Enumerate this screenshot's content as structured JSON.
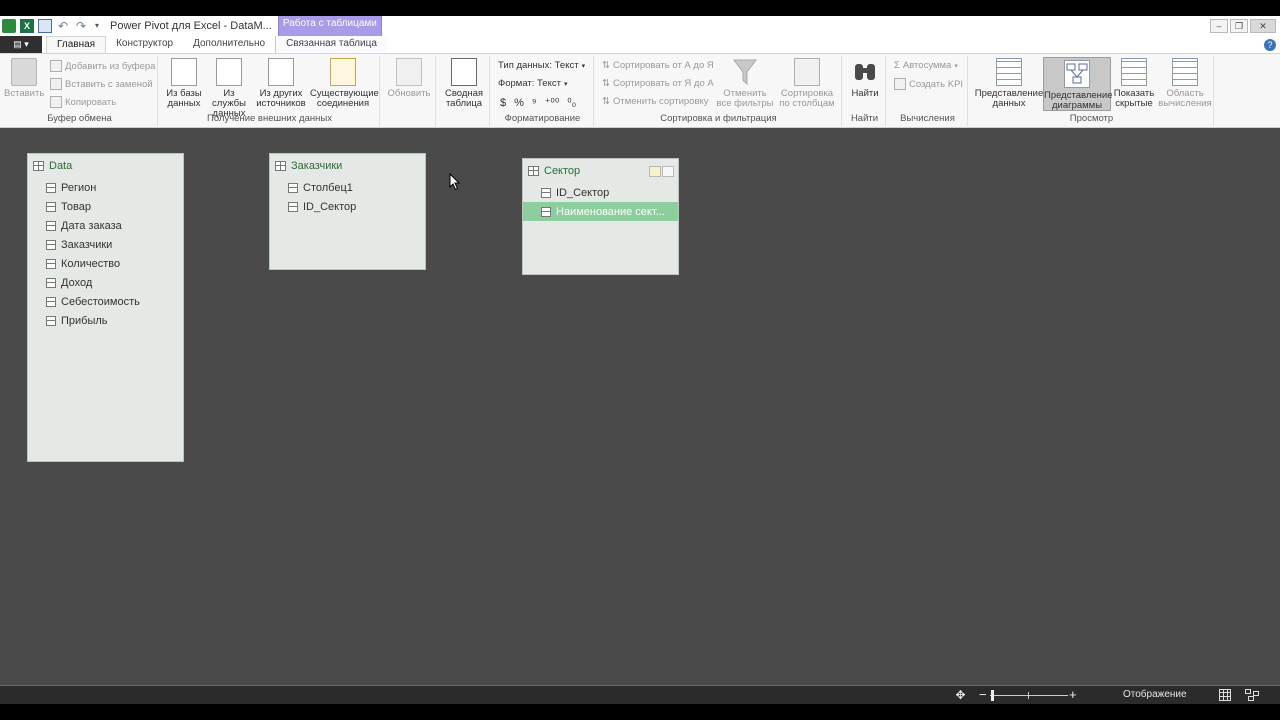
{
  "window": {
    "title": "Power Pivot для Excel - DataM...",
    "context_tab_title": "Работа с таблицами"
  },
  "tabs": {
    "file": "▤ ▾",
    "items": [
      "Главная",
      "Конструктор",
      "Дополнительно",
      "Связанная таблица"
    ],
    "active": "Главная"
  },
  "ribbon": {
    "clipboard": {
      "paste": "Вставить",
      "add_from_clipboard": "Добавить из буфера",
      "paste_replace": "Вставить с заменой",
      "copy": "Копировать",
      "label": "Буфер обмена"
    },
    "external": {
      "from_db": "Из базы\nданных",
      "from_service": "Из службы\nданных",
      "from_other": "Из других\nисточников",
      "existing": "Существующие\nсоединения",
      "label": "Получение внешних данных"
    },
    "refresh": {
      "label": "Обновить"
    },
    "pivot": {
      "label": "Сводная\nтаблица"
    },
    "format": {
      "data_type": "Тип данных: Текст",
      "format": "Формат: Текст",
      "currency": "$",
      "percent": "%",
      "comma": "⁹",
      "inc_dec": "⁺⁰⁰",
      "dec_dec": "⁰₀",
      "label": "Форматирование"
    },
    "sort": {
      "az": "Сортировать от А до Я",
      "za": "Сортировать от Я до А",
      "clear": "Отменить сортировку",
      "clear_filters": "Отменить\nвсе фильтры",
      "by_column": "Сортировка\nпо столбцам",
      "label": "Сортировка и фильтрация"
    },
    "find": {
      "button": "Найти",
      "label": "Найти"
    },
    "calc": {
      "autosum": "Автосумма",
      "kpi": "Создать KPI",
      "label": "Вычисления"
    },
    "view": {
      "data_view": "Представление\nданных",
      "diagram_view": "Представление\nдиаграммы",
      "show_hidden": "Показать\nскрытые",
      "calc_area": "Область\nвычисления",
      "label": "Просмотр"
    }
  },
  "tables": [
    {
      "name": "Data",
      "columns": [
        "Регион",
        "Товар",
        "Дата заказа",
        "Заказчики",
        "Количество",
        "Доход",
        "Себестоимость",
        "Прибыль"
      ]
    },
    {
      "name": "Заказчики",
      "columns": [
        "Столбец1",
        "ID_Сектор"
      ]
    },
    {
      "name": "Сектор",
      "columns": [
        "ID_Сектор",
        "Наименование сект..."
      ],
      "selected_column": "Наименование сект..."
    }
  ],
  "statusbar": {
    "display_label": "Отображение"
  }
}
